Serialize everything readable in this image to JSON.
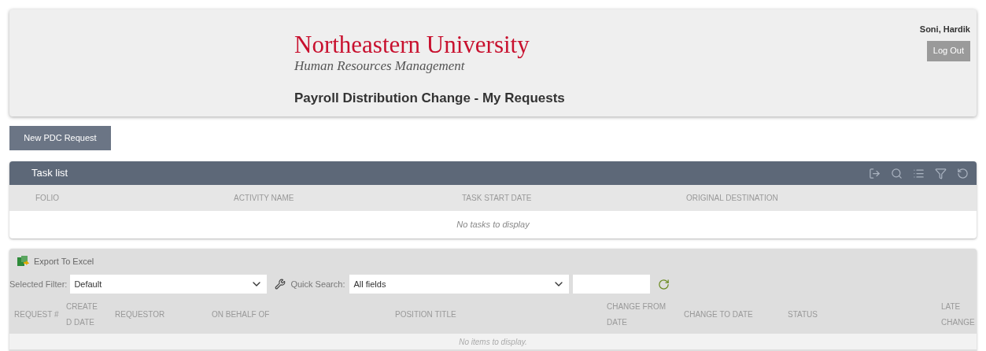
{
  "header": {
    "university": "Northeastern University",
    "department": "Human Resources Management",
    "page_title": "Payroll Distribution Change - My Requests",
    "user_name": "Soni, Hardik",
    "logout_button": "Log Out"
  },
  "new_request_button": "New PDC Request",
  "task_list": {
    "title": "Task list",
    "columns": [
      "FOLIO",
      "ACTIVITY NAME",
      "TASK START DATE",
      "ORIGINAL DESTINATION"
    ],
    "empty_message": "No tasks to display"
  },
  "requests": {
    "export_button": "Export To Excel",
    "filter_label": "Selected Filter:",
    "filter_value": "Default",
    "quick_search_label": "Quick Search:",
    "quick_search_field": "All fields",
    "columns": [
      "REQUEST #",
      "CREATE D DATE",
      "REQUESTOR",
      "ON BEHALF OF",
      "POSITION TITLE",
      "CHANGE FROM DATE",
      "CHANGE TO DATE",
      "STATUS",
      "LATE CHANGE"
    ],
    "empty_message": "No items to display."
  }
}
